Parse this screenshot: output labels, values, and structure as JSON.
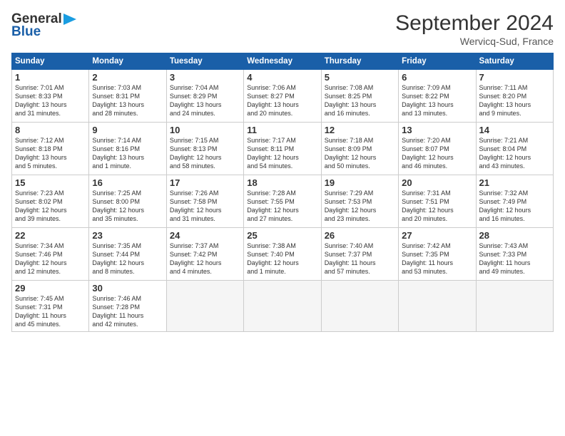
{
  "logo": {
    "line1": "General",
    "line2": "Blue"
  },
  "header": {
    "title": "September 2024",
    "location": "Wervicq-Sud, France"
  },
  "days_of_week": [
    "Sunday",
    "Monday",
    "Tuesday",
    "Wednesday",
    "Thursday",
    "Friday",
    "Saturday"
  ],
  "weeks": [
    [
      {
        "day": "1",
        "info": "Sunrise: 7:01 AM\nSunset: 8:33 PM\nDaylight: 13 hours\nand 31 minutes."
      },
      {
        "day": "2",
        "info": "Sunrise: 7:03 AM\nSunset: 8:31 PM\nDaylight: 13 hours\nand 28 minutes."
      },
      {
        "day": "3",
        "info": "Sunrise: 7:04 AM\nSunset: 8:29 PM\nDaylight: 13 hours\nand 24 minutes."
      },
      {
        "day": "4",
        "info": "Sunrise: 7:06 AM\nSunset: 8:27 PM\nDaylight: 13 hours\nand 20 minutes."
      },
      {
        "day": "5",
        "info": "Sunrise: 7:08 AM\nSunset: 8:25 PM\nDaylight: 13 hours\nand 16 minutes."
      },
      {
        "day": "6",
        "info": "Sunrise: 7:09 AM\nSunset: 8:22 PM\nDaylight: 13 hours\nand 13 minutes."
      },
      {
        "day": "7",
        "info": "Sunrise: 7:11 AM\nSunset: 8:20 PM\nDaylight: 13 hours\nand 9 minutes."
      }
    ],
    [
      {
        "day": "8",
        "info": "Sunrise: 7:12 AM\nSunset: 8:18 PM\nDaylight: 13 hours\nand 5 minutes."
      },
      {
        "day": "9",
        "info": "Sunrise: 7:14 AM\nSunset: 8:16 PM\nDaylight: 13 hours\nand 1 minute."
      },
      {
        "day": "10",
        "info": "Sunrise: 7:15 AM\nSunset: 8:13 PM\nDaylight: 12 hours\nand 58 minutes."
      },
      {
        "day": "11",
        "info": "Sunrise: 7:17 AM\nSunset: 8:11 PM\nDaylight: 12 hours\nand 54 minutes."
      },
      {
        "day": "12",
        "info": "Sunrise: 7:18 AM\nSunset: 8:09 PM\nDaylight: 12 hours\nand 50 minutes."
      },
      {
        "day": "13",
        "info": "Sunrise: 7:20 AM\nSunset: 8:07 PM\nDaylight: 12 hours\nand 46 minutes."
      },
      {
        "day": "14",
        "info": "Sunrise: 7:21 AM\nSunset: 8:04 PM\nDaylight: 12 hours\nand 43 minutes."
      }
    ],
    [
      {
        "day": "15",
        "info": "Sunrise: 7:23 AM\nSunset: 8:02 PM\nDaylight: 12 hours\nand 39 minutes."
      },
      {
        "day": "16",
        "info": "Sunrise: 7:25 AM\nSunset: 8:00 PM\nDaylight: 12 hours\nand 35 minutes."
      },
      {
        "day": "17",
        "info": "Sunrise: 7:26 AM\nSunset: 7:58 PM\nDaylight: 12 hours\nand 31 minutes."
      },
      {
        "day": "18",
        "info": "Sunrise: 7:28 AM\nSunset: 7:55 PM\nDaylight: 12 hours\nand 27 minutes."
      },
      {
        "day": "19",
        "info": "Sunrise: 7:29 AM\nSunset: 7:53 PM\nDaylight: 12 hours\nand 23 minutes."
      },
      {
        "day": "20",
        "info": "Sunrise: 7:31 AM\nSunset: 7:51 PM\nDaylight: 12 hours\nand 20 minutes."
      },
      {
        "day": "21",
        "info": "Sunrise: 7:32 AM\nSunset: 7:49 PM\nDaylight: 12 hours\nand 16 minutes."
      }
    ],
    [
      {
        "day": "22",
        "info": "Sunrise: 7:34 AM\nSunset: 7:46 PM\nDaylight: 12 hours\nand 12 minutes."
      },
      {
        "day": "23",
        "info": "Sunrise: 7:35 AM\nSunset: 7:44 PM\nDaylight: 12 hours\nand 8 minutes."
      },
      {
        "day": "24",
        "info": "Sunrise: 7:37 AM\nSunset: 7:42 PM\nDaylight: 12 hours\nand 4 minutes."
      },
      {
        "day": "25",
        "info": "Sunrise: 7:38 AM\nSunset: 7:40 PM\nDaylight: 12 hours\nand 1 minute."
      },
      {
        "day": "26",
        "info": "Sunrise: 7:40 AM\nSunset: 7:37 PM\nDaylight: 11 hours\nand 57 minutes."
      },
      {
        "day": "27",
        "info": "Sunrise: 7:42 AM\nSunset: 7:35 PM\nDaylight: 11 hours\nand 53 minutes."
      },
      {
        "day": "28",
        "info": "Sunrise: 7:43 AM\nSunset: 7:33 PM\nDaylight: 11 hours\nand 49 minutes."
      }
    ],
    [
      {
        "day": "29",
        "info": "Sunrise: 7:45 AM\nSunset: 7:31 PM\nDaylight: 11 hours\nand 45 minutes."
      },
      {
        "day": "30",
        "info": "Sunrise: 7:46 AM\nSunset: 7:28 PM\nDaylight: 11 hours\nand 42 minutes."
      },
      {
        "day": "",
        "info": ""
      },
      {
        "day": "",
        "info": ""
      },
      {
        "day": "",
        "info": ""
      },
      {
        "day": "",
        "info": ""
      },
      {
        "day": "",
        "info": ""
      }
    ]
  ]
}
